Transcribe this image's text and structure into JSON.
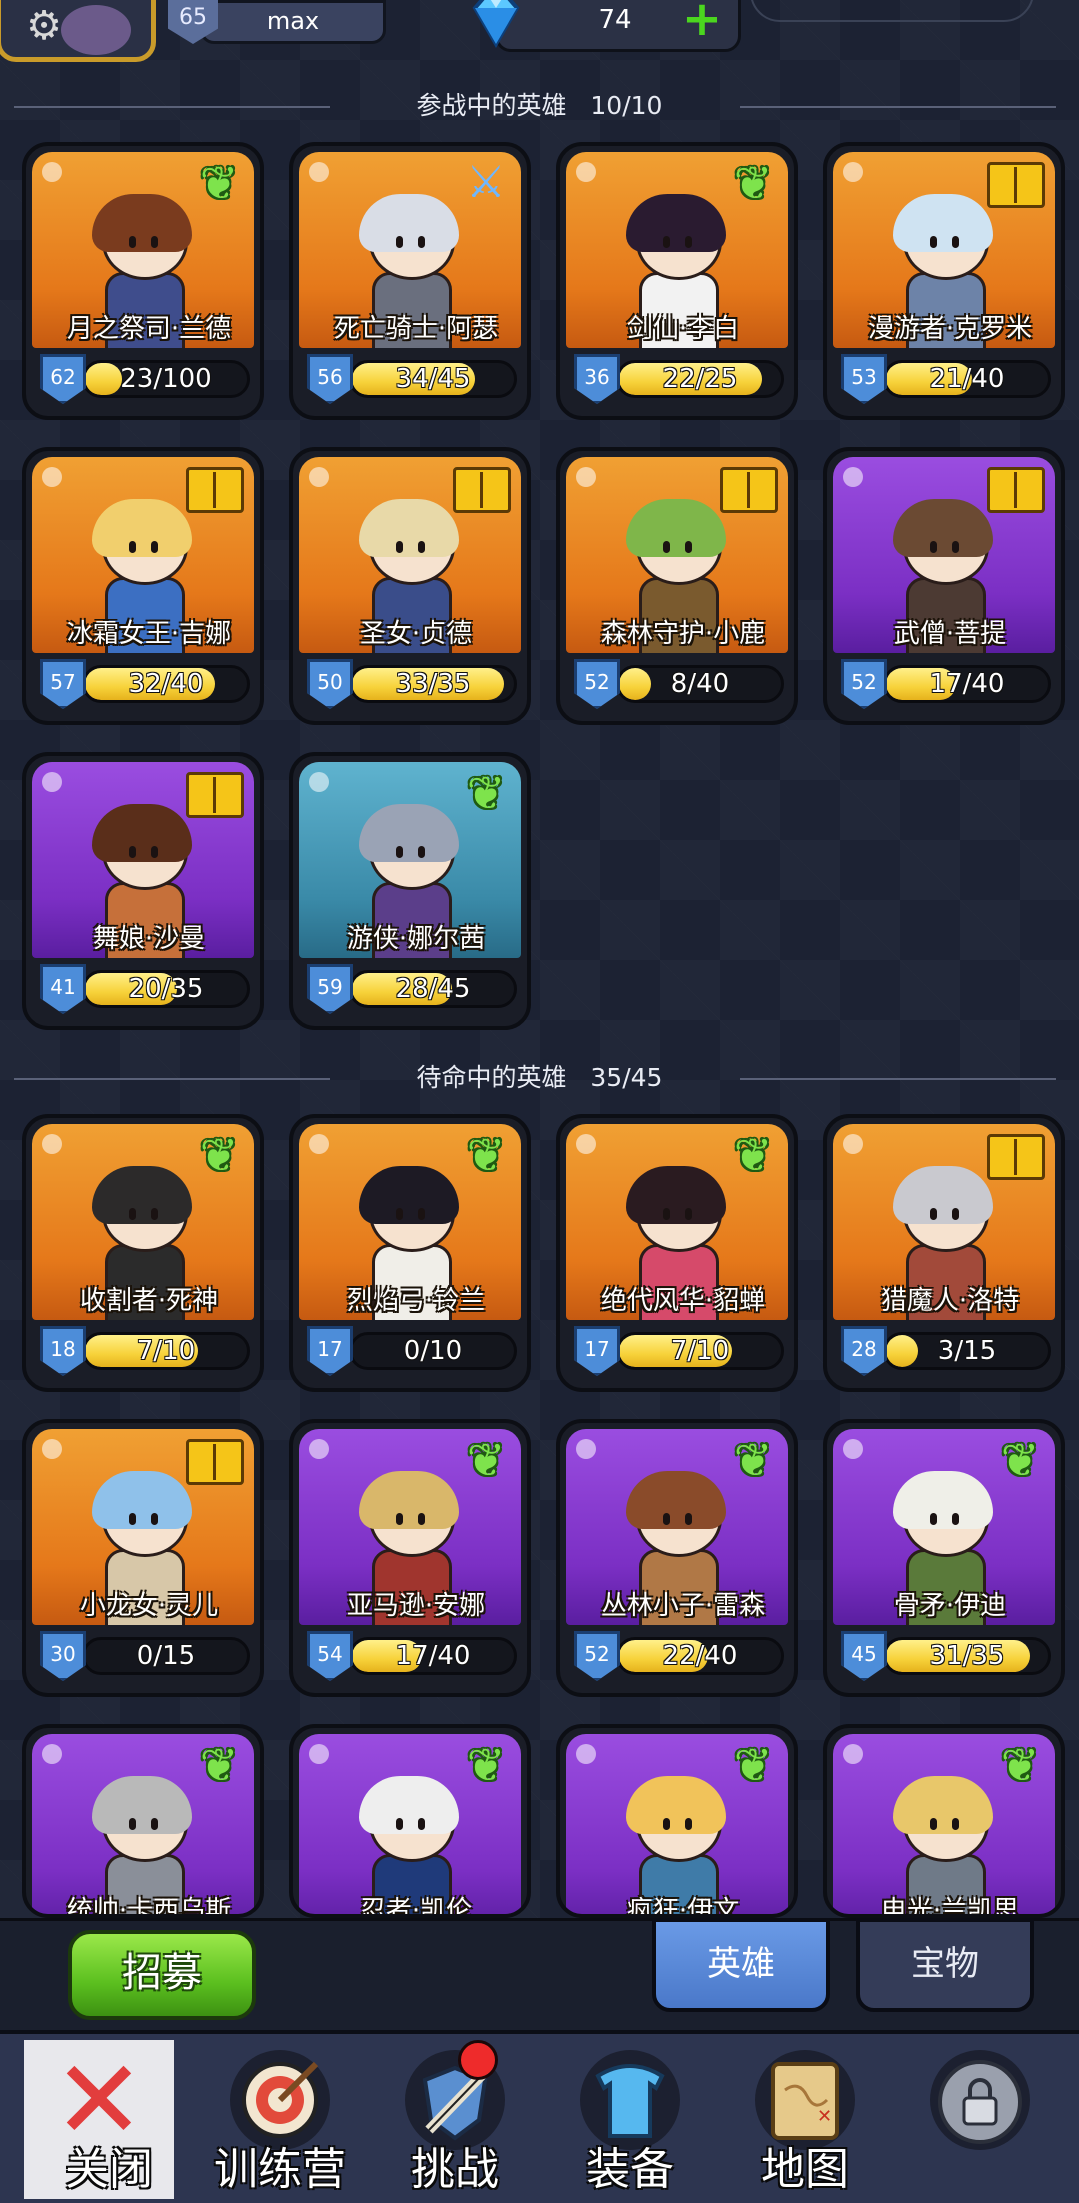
{
  "topbar": {
    "player_level": "65",
    "player_name": "max",
    "gems": "74",
    "gear_icon": "gear-icon",
    "add_icon": "plus-icon"
  },
  "sections": {
    "active_title": "参战中的英雄",
    "active_count": "10/10",
    "reserve_title": "待命中的英雄",
    "reserve_count": "35/45"
  },
  "active_heroes": [
    {
      "name": "月之祭司·兰德",
      "level": "62",
      "progress_text": "23/100",
      "progress": 0.23,
      "color": "orange",
      "badge": "wing"
    },
    {
      "name": "死亡骑士·阿瑟",
      "level": "56",
      "progress_text": "34/45",
      "progress": 0.76,
      "color": "orange",
      "badge": "sword"
    },
    {
      "name": "剑仙·李白",
      "level": "36",
      "progress_text": "22/25",
      "progress": 0.88,
      "color": "orange",
      "badge": "wing"
    },
    {
      "name": "漫游者·克罗米",
      "level": "53",
      "progress_text": "21/40",
      "progress": 0.53,
      "color": "orange",
      "badge": "book"
    },
    {
      "name": "冰霜女王·吉娜",
      "level": "57",
      "progress_text": "32/40",
      "progress": 0.8,
      "color": "orange",
      "badge": "book"
    },
    {
      "name": "圣女·贞德",
      "level": "50",
      "progress_text": "33/35",
      "progress": 0.94,
      "color": "orange",
      "badge": "book"
    },
    {
      "name": "森林守护·小鹿",
      "level": "52",
      "progress_text": "8/40",
      "progress": 0.2,
      "color": "orange",
      "badge": "book"
    },
    {
      "name": "武僧·菩提",
      "level": "52",
      "progress_text": "17/40",
      "progress": 0.43,
      "color": "purple",
      "badge": "book"
    },
    {
      "name": "舞娘·沙曼",
      "level": "41",
      "progress_text": "20/35",
      "progress": 0.57,
      "color": "purple",
      "badge": "book"
    },
    {
      "name": "游侠·娜尔茜",
      "level": "59",
      "progress_text": "28/45",
      "progress": 0.62,
      "color": "blue",
      "badge": "wing"
    }
  ],
  "reserve_heroes": [
    {
      "name": "收割者·死神",
      "level": "18",
      "progress_text": "7/10",
      "progress": 0.7,
      "color": "orange",
      "badge": "wing"
    },
    {
      "name": "烈焰弓·铃兰",
      "level": "17",
      "progress_text": "0/10",
      "progress": 0.0,
      "color": "orange",
      "badge": "wing"
    },
    {
      "name": "绝代风华·貂蝉",
      "level": "17",
      "progress_text": "7/10",
      "progress": 0.7,
      "color": "orange",
      "badge": "wing"
    },
    {
      "name": "猎魔人·洛特",
      "level": "28",
      "progress_text": "3/15",
      "progress": 0.2,
      "color": "orange",
      "badge": "book"
    },
    {
      "name": "小龙女·灵儿",
      "level": "30",
      "progress_text": "0/15",
      "progress": 0.0,
      "color": "orange",
      "badge": "book"
    },
    {
      "name": "亚马逊·安娜",
      "level": "54",
      "progress_text": "17/40",
      "progress": 0.43,
      "color": "purple",
      "badge": "wing"
    },
    {
      "name": "丛林小子·雷森",
      "level": "52",
      "progress_text": "22/40",
      "progress": 0.55,
      "color": "purple",
      "badge": "wing"
    },
    {
      "name": "骨矛·伊迪",
      "level": "45",
      "progress_text": "31/35",
      "progress": 0.89,
      "color": "purple",
      "badge": "wing"
    },
    {
      "name": "统帅·卡西乌斯",
      "level": "",
      "progress_text": "",
      "progress": 0,
      "color": "purple",
      "badge": "wing"
    },
    {
      "name": "忍者·凯伦",
      "level": "",
      "progress_text": "",
      "progress": 0,
      "color": "purple",
      "badge": "wing"
    },
    {
      "name": "疯狂·伊文",
      "level": "",
      "progress_text": "",
      "progress": 0,
      "color": "purple",
      "badge": "wing"
    },
    {
      "name": "电光·兰凯思",
      "level": "",
      "progress_text": "",
      "progress": 0,
      "color": "purple",
      "badge": "wing"
    }
  ],
  "actions": {
    "recruit": "招募",
    "tab_heroes": "英雄",
    "tab_treasure": "宝物"
  },
  "nav": {
    "close": "关闭",
    "training": "训练营",
    "challenge": "挑战",
    "equipment": "装备",
    "map": "地图"
  }
}
